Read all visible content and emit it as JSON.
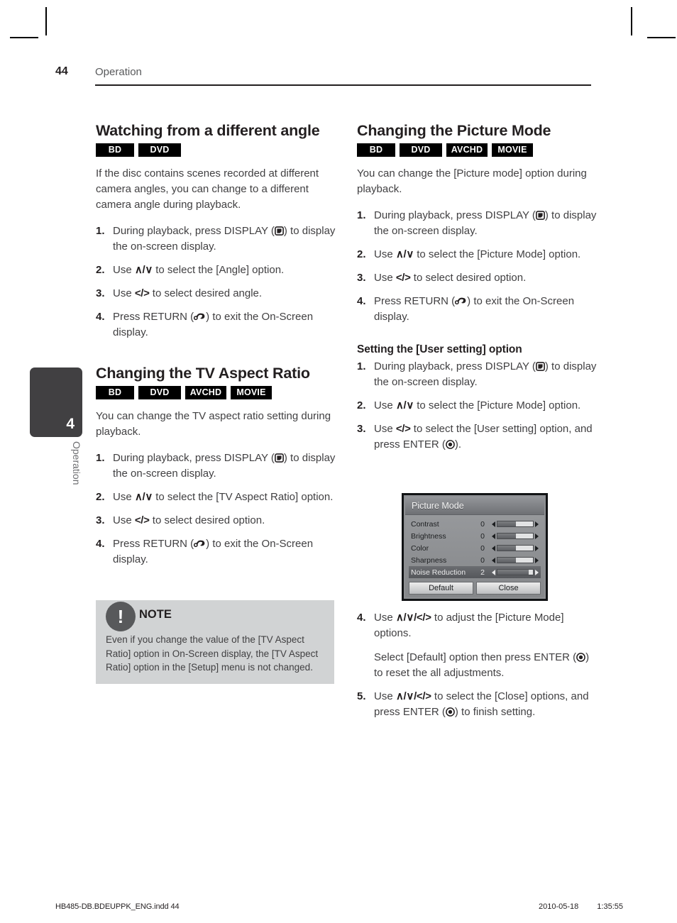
{
  "header": {
    "page_number": "44",
    "title": "Operation"
  },
  "side_tab": {
    "number": "4",
    "label": "Operation"
  },
  "icons": {
    "display": "display-button-icon",
    "return": "return-button-icon",
    "enter": "enter-button-icon"
  },
  "left_column": {
    "section1": {
      "title": "Watching from a different angle",
      "badges": [
        "BD",
        "DVD"
      ],
      "intro": "If the disc contains scenes recorded at different camera angles, you can change to a different camera angle during playback.",
      "steps": [
        {
          "num": "1.",
          "pre": "During playback, press DISPLAY (",
          "post": ") to display the on-screen display.",
          "icon": "display"
        },
        {
          "num": "2.",
          "pre": "Use ",
          "keys": "∧/∨",
          "post": " to select the [Angle] option."
        },
        {
          "num": "3.",
          "pre": "Use ",
          "keys": "</>",
          "post": " to select desired angle."
        },
        {
          "num": "4.",
          "pre": "Press RETURN (",
          "post": ") to exit the On-Screen display.",
          "icon": "return"
        }
      ]
    },
    "section2": {
      "title": "Changing the TV Aspect Ratio",
      "badges": [
        "BD",
        "DVD",
        "AVCHD",
        "MOVIE"
      ],
      "intro": "You can change the TV aspect ratio setting during playback.",
      "steps": [
        {
          "num": "1.",
          "pre": "During playback, press DISPLAY (",
          "post": ") to display the on-screen display.",
          "icon": "display"
        },
        {
          "num": "2.",
          "pre": "Use ",
          "keys": "∧/∨",
          "post": " to select the [TV Aspect Ratio] option."
        },
        {
          "num": "3.",
          "pre": "Use ",
          "keys": "</>",
          "post": " to select desired option."
        },
        {
          "num": "4.",
          "pre": "Press RETURN (",
          "post": ") to exit the On-Screen display.",
          "icon": "return"
        }
      ]
    },
    "note": {
      "title": "NOTE",
      "mark": "!",
      "body": "Even if you change the value of the [TV Aspect Ratio] option in On-Screen display, the [TV Aspect Ratio] option in the [Setup] menu is not changed."
    }
  },
  "right_column": {
    "section1": {
      "title": "Changing the Picture Mode",
      "badges": [
        "BD",
        "DVD",
        "AVCHD",
        "MOVIE"
      ],
      "intro": "You can change the [Picture mode] option during playback.",
      "steps": [
        {
          "num": "1.",
          "pre": "During playback, press DISPLAY (",
          "post": ") to display the on-screen display.",
          "icon": "display"
        },
        {
          "num": "2.",
          "pre": "Use ",
          "keys": "∧/∨",
          "post": " to select the [Picture Mode] option."
        },
        {
          "num": "3.",
          "pre": "Use ",
          "keys": "</>",
          "post": " to select desired option."
        },
        {
          "num": "4.",
          "pre": "Press RETURN (",
          "post": ") to exit the On-Screen display.",
          "icon": "return"
        }
      ]
    },
    "subsection": {
      "title": "Setting the [User setting] option",
      "steps": [
        {
          "num": "1.",
          "pre": "During playback, press DISPLAY (",
          "post": ") to display the on-screen display.",
          "icon": "display"
        },
        {
          "num": "2.",
          "pre": "Use ",
          "keys": "∧/∨",
          "post": " to select the [Picture Mode] option."
        },
        {
          "num": "3.",
          "pre": "Use ",
          "keys": "</>",
          "post": " to select the [User setting] option, and press ENTER (",
          "post2": ").",
          "icon": "enter"
        }
      ],
      "steps_after": [
        {
          "num": "4.",
          "pre": "Use ",
          "keys": "∧/∨/</>",
          "post": " to adjust the [Picture Mode] options.",
          "cont_pre": "Select [Default] option then press ENTER (",
          "cont_post": ") to reset the all adjustments.",
          "icon": "enter"
        },
        {
          "num": "5.",
          "pre": "Use ",
          "keys": "∧/∨/</>",
          "post": " to select the [Close] options, and press ENTER (",
          "post2": ") to finish setting.",
          "icon": "enter"
        }
      ]
    }
  },
  "picture_mode_dialog": {
    "title": "Picture Mode",
    "rows": [
      {
        "label": "Contrast",
        "value": "0",
        "fill_percent": 52,
        "selected": false
      },
      {
        "label": "Brightness",
        "value": "0",
        "fill_percent": 52,
        "selected": false
      },
      {
        "label": "Color",
        "value": "0",
        "fill_percent": 52,
        "selected": false
      },
      {
        "label": "Sharpness",
        "value": "0",
        "fill_percent": 52,
        "selected": false
      },
      {
        "label": "Noise Reduction",
        "value": "2",
        "fill_percent": 88,
        "selected": true
      }
    ],
    "buttons": [
      {
        "label": "Default"
      },
      {
        "label": "Close"
      }
    ]
  },
  "footer": {
    "file": "HB485-DB.BDEUPPK_ENG.indd   44",
    "date": "2010-05-18",
    "time": "1:35:55"
  }
}
